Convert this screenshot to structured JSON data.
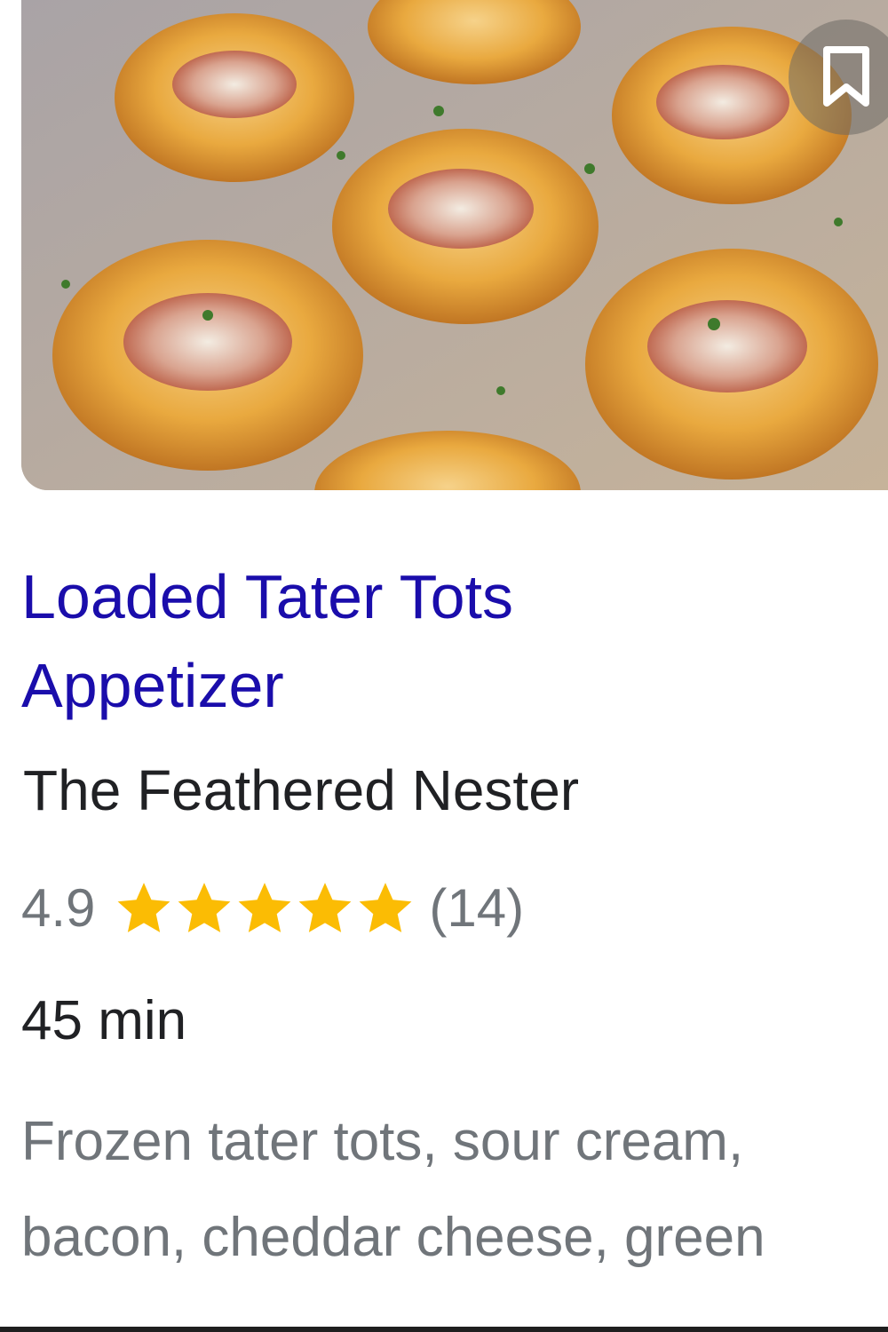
{
  "recipe": {
    "image_alt": "Loaded tater tot cups on a baking sheet",
    "save_icon": "bookmark-icon",
    "title": "Loaded Tater Tots Appetizer",
    "source": "The Feathered Nester",
    "rating": "4.9",
    "rating_value": 4.9,
    "star_count": 5,
    "reviews": "(14)",
    "time": "45 min",
    "ingredients": "Frozen tater tots, sour cream, bacon, cheddar cheese, green"
  },
  "colors": {
    "title_link": "#1a0dab",
    "star": "#fbbc04",
    "muted_text": "#70757a",
    "primary_text": "#202124"
  }
}
